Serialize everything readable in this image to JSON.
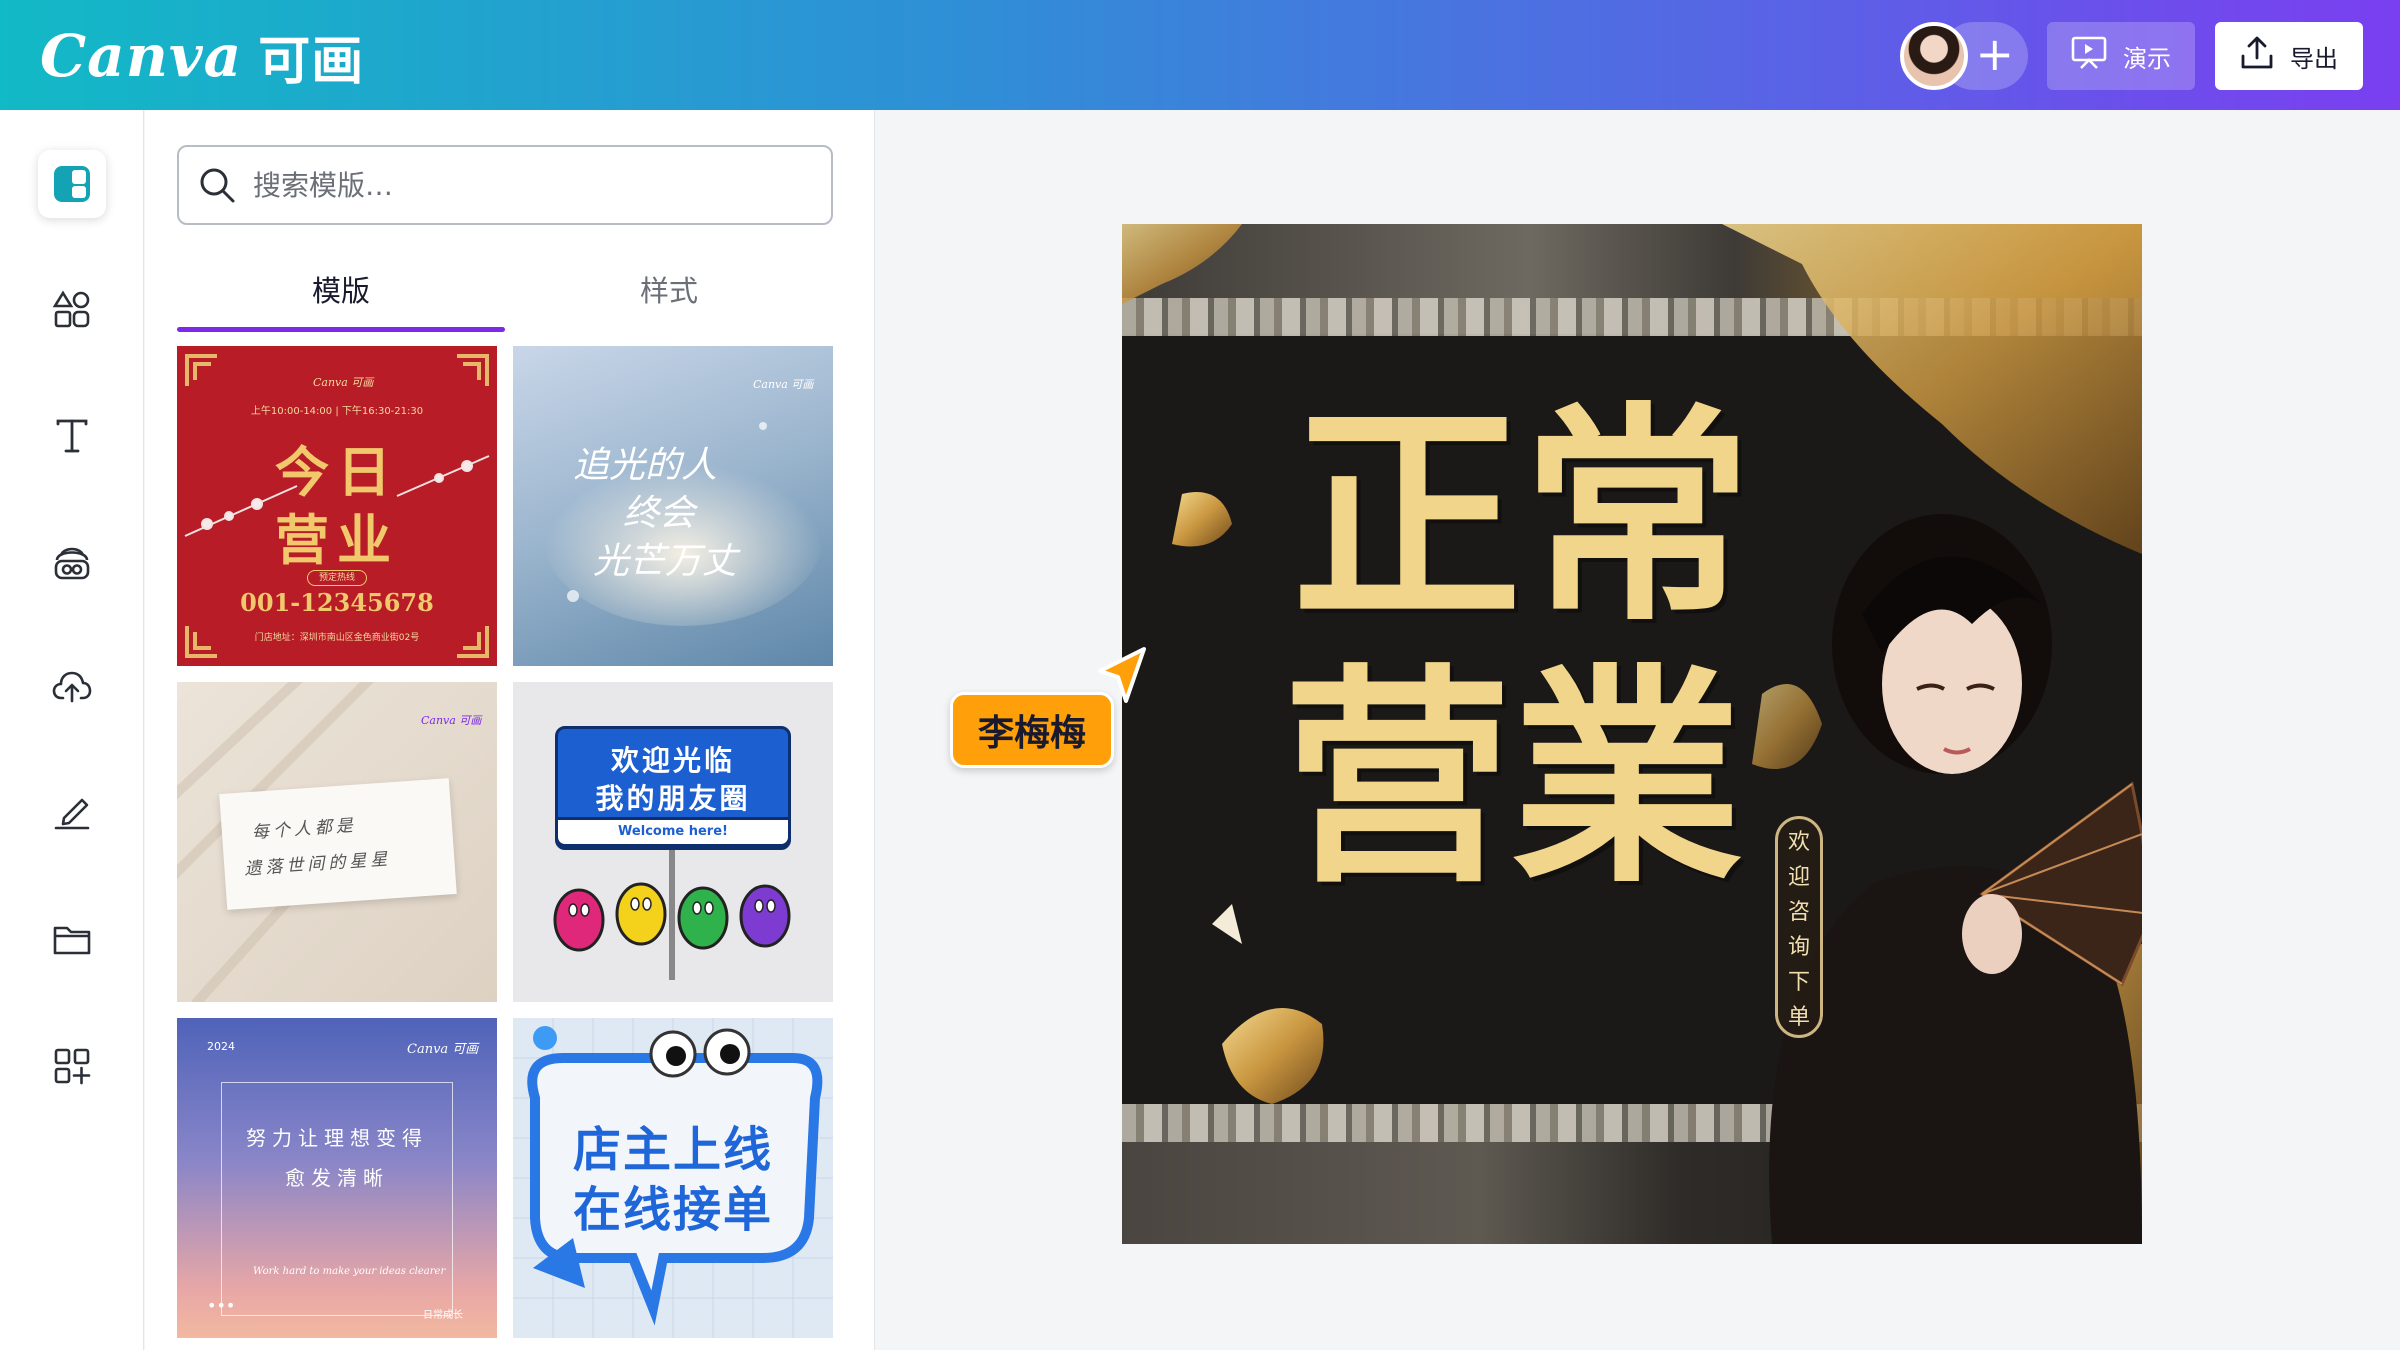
{
  "app": {
    "logo_text": "Canva",
    "logo_cn": "可画",
    "colors": {
      "accent": "#7d2ae8",
      "brand_start": "#12b9c6",
      "brand_end": "#7a3ff0",
      "cursor_label": "#ff9f0a"
    }
  },
  "header": {
    "present_label": "演示",
    "export_label": "导出",
    "add_collaborator_icon": "plus-icon"
  },
  "rail": {
    "items": [
      {
        "icon": "templates-icon",
        "active": true
      },
      {
        "icon": "elements-icon"
      },
      {
        "icon": "text-icon"
      },
      {
        "icon": "brand-icon"
      },
      {
        "icon": "uploads-icon"
      },
      {
        "icon": "draw-icon"
      },
      {
        "icon": "projects-icon"
      },
      {
        "icon": "apps-icon"
      }
    ]
  },
  "panel": {
    "search_placeholder": "搜索模版…",
    "tabs": [
      {
        "label": "模版",
        "active": true
      },
      {
        "label": "样式",
        "active": false
      }
    ],
    "templates": [
      {
        "brand": "Canva 可画",
        "hours": "上午10:00-14:00 | 下午16:30-21:30",
        "title_1": "今日",
        "title_2": "营业",
        "hotline_label": "预定热线",
        "phone": "001-12345678",
        "address": "门店地址：深圳市南山区金色商业街02号"
      },
      {
        "brand": "Canva 可画",
        "quote_1": "追光的人",
        "quote_2": "终会",
        "quote_3": "光芒万丈"
      },
      {
        "brand": "Canva 可画",
        "note_1": "每个人都是",
        "note_2": "遗落世间的星星"
      },
      {
        "headline_1": "欢迎光临",
        "headline_2": "我的朋友圈",
        "subline": "Welcome here!"
      },
      {
        "year": "2024",
        "brand": "Canva 可画",
        "line_1": "努力让理想变得",
        "line_2": "愈发清晰",
        "script": "Work hard to make your ideas clearer",
        "more": "•••",
        "footer": "日常成长"
      },
      {
        "line_1": "店主上线",
        "line_2": "在线接单"
      }
    ]
  },
  "canvas": {
    "headline_1": "正常",
    "headline_2": "营業",
    "badge": [
      "欢",
      "迎",
      "咨",
      "询",
      "下",
      "单"
    ],
    "collaborator_name": "李梅梅"
  }
}
